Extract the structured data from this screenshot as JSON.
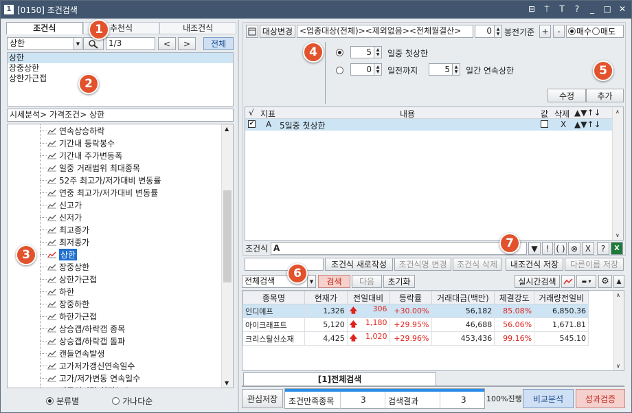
{
  "window": {
    "num": "1",
    "title": "[0150] 조건검색",
    "icons": [
      "⊟",
      "⍑",
      "T",
      "?",
      "_",
      "□",
      "✕"
    ]
  },
  "left": {
    "tabs": [
      "조건식",
      "추천식",
      "내조건식"
    ],
    "search_value": "상한",
    "page": "1/3",
    "prev": "<",
    "next": ">",
    "all": "전체",
    "results": [
      "상한",
      "장중상한",
      "상한가근접"
    ],
    "breadcrumb": "시세분석> 가격조건> 상한",
    "tree": [
      "연속상승하락",
      "기간내 등락봉수",
      "기간내 주가변동폭",
      "일중 거래범위 최대종목",
      "52주 최고가/저가대비 변동률",
      "연중 최고가/저가대비 변동률",
      "신고가",
      "신저가",
      "최고종가",
      "최저종가",
      "상한",
      "장중상한",
      "상한가근접",
      "하한",
      "장중하한",
      "하한가근접",
      "상승갭/하락갭 종목",
      "상승갭/하락갭 돌파",
      "캔들연속발생",
      "고가저가갱신연속일수",
      "고가/저가변동 연속일수",
      "변동성이탈/회귀(%)"
    ],
    "sort_radio": [
      "분류별",
      "가나다순"
    ]
  },
  "right": {
    "target_btn": "대상변경",
    "target_text": "<업종대상(전체)><제외없음><전체월결산>",
    "bar_value": "0",
    "bar_label": "봉전기준",
    "plus": "+",
    "minus": "-",
    "buy": "매수",
    "sell": "매도",
    "opt1_val": "5",
    "opt1_label": "일중 첫상한",
    "opt2_val": "0",
    "opt2_label": "일전까지",
    "opt2_val2": "5",
    "opt2_label2": "일간 연속상한",
    "edit": "수정",
    "add": "추가",
    "cond_headers": [
      "√",
      "지표",
      "내용",
      "값",
      "삭제",
      "▲▼↑↓"
    ],
    "cond_row": {
      "id": "A",
      "content": "5일중 첫상한",
      "del": "X",
      "arrows": "▲▼↑↓"
    },
    "expr_label": "조건식",
    "expr_value": "A",
    "expr_tools": [
      "▼",
      "!",
      "( )",
      "⊗",
      "X",
      "?"
    ],
    "buttons": [
      "조건식 새로작성",
      "조건식명 변경",
      "조건식 삭제",
      "내조건식 저장",
      "다른이름 저장"
    ],
    "search_scope": "전체검색",
    "search": "검색",
    "next": "다음",
    "reset": "초기화",
    "realtime": "실시간검색",
    "grid_headers": [
      "종목명",
      "현재가",
      "전일대비",
      "등락률",
      "거래대금(백만)",
      "체결강도",
      "거래량전일비"
    ],
    "rows": [
      {
        "name": "인디에프",
        "price": "1,326",
        "diff": "306",
        "rate": "+30.00%",
        "amt": "56,182",
        "power": "85.08%",
        "vol": "6,850.36"
      },
      {
        "name": "아이크래프트",
        "price": "5,120",
        "diff": "1,180",
        "rate": "+29.95%",
        "amt": "46,688",
        "power": "56.06%",
        "vol": "1,671.81"
      },
      {
        "name": "크리스탈신소재",
        "price": "4,425",
        "diff": "1,020",
        "rate": "+29.96%",
        "amt": "453,436",
        "power": "99.16%",
        "vol": "545.10"
      }
    ],
    "result_tab": "[1]전체검색",
    "bottom": {
      "save": "관심저장",
      "cond_count_label": "조건만족종목",
      "cond_count": "3",
      "result_label": "검색결과",
      "result": "3",
      "progress": "100%진행",
      "progress_value": 100,
      "compare": "비교분석",
      "perf": "성과검증"
    }
  },
  "markers": [
    "1",
    "2",
    "3",
    "4",
    "5",
    "6",
    "7"
  ],
  "colors": {
    "title": "#41566e",
    "marker": "#e2522d",
    "up": "#e0241c",
    "select": "#cde4f5"
  }
}
